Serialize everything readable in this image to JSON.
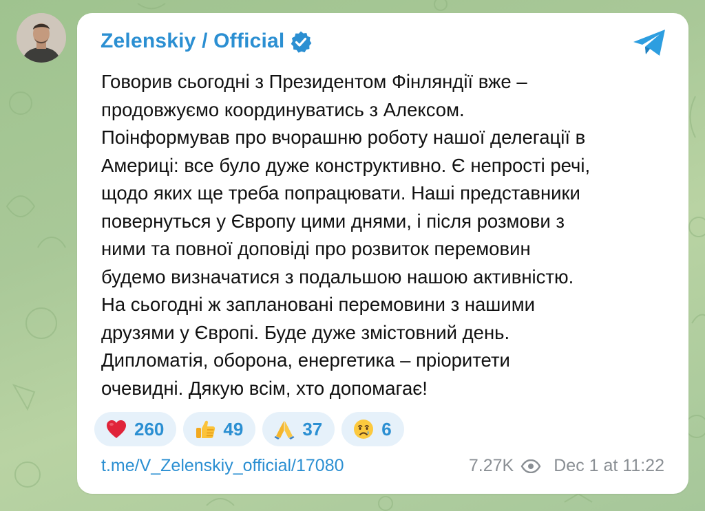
{
  "channel": {
    "name": "Zelenskiy / Official",
    "verified": true
  },
  "message": {
    "lines": [
      "Говорив сьогодні з Президентом Фінляндії вже –",
      "продовжуємо координуватись з Алексом.",
      "Поінформував про вчорашню роботу нашої делегації в",
      "Америці: все було дуже конструктивно. Є непрості речі,",
      "щодо яких ще треба попрацювати. Наші представники",
      "повернуться у Європу цими днями, і після розмови з",
      "ними та повної доповіді про розвиток перемовин",
      "будемо визначатися з подальшою нашою активністю.",
      "На сьогодні ж заплановані перемовини з нашими",
      "друзями у Європі. Буде дуже змістовний день.",
      "Дипломатія, оборона, енергетика – пріоритети",
      "очевидні. Дякую всім, хто допомагає!"
    ]
  },
  "reactions": [
    {
      "emoji": "red-heart",
      "count": "260"
    },
    {
      "emoji": "thumbs-up",
      "count": "49"
    },
    {
      "emoji": "folded-hands",
      "count": "37"
    },
    {
      "emoji": "crying-face",
      "count": "6"
    }
  ],
  "footer": {
    "link": "t.me/V_Zelenskiy_official/17080",
    "views": "7.27K",
    "date": "Dec 1 at 11:22"
  },
  "colors": {
    "accent": "#2b8fd2",
    "reaction_bg": "#e6f1fa",
    "meta": "#8a8f94",
    "background": "#a9c898"
  }
}
